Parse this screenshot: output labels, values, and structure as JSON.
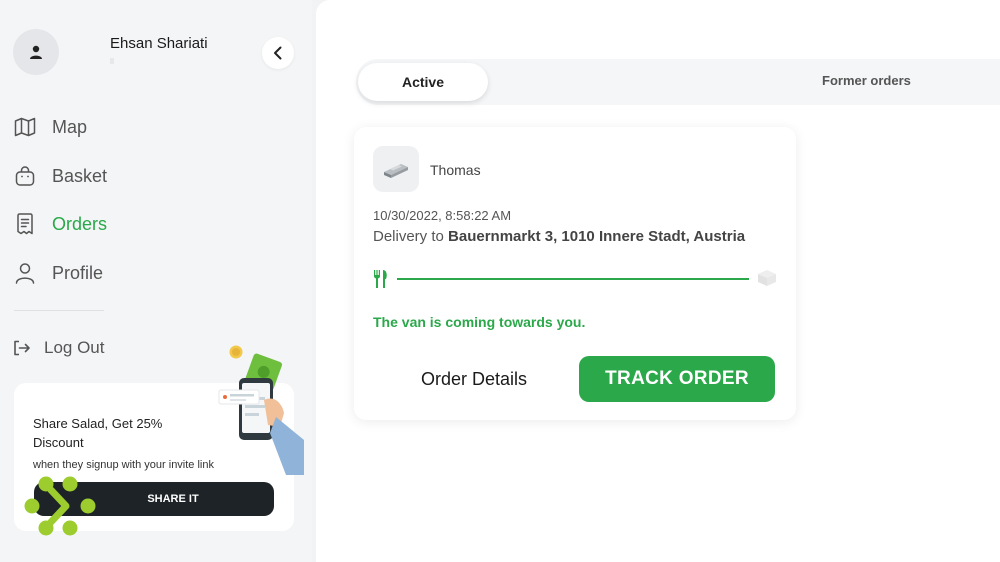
{
  "user": {
    "name": "Ehsan Shariati"
  },
  "nav": {
    "items": [
      {
        "label": "Map",
        "icon": "map-icon",
        "active": false
      },
      {
        "label": "Basket",
        "icon": "basket-icon",
        "active": false
      },
      {
        "label": "Orders",
        "icon": "receipt-icon",
        "active": true
      },
      {
        "label": "Profile",
        "icon": "user-icon",
        "active": false
      }
    ],
    "logout_label": "Log Out"
  },
  "promo": {
    "title": "Share Salad, Get 25% Discount",
    "subtitle": "when they signup with your invite link",
    "button_label": "SHARE IT"
  },
  "tabs": {
    "active_label": "Active",
    "former_label": "Former orders"
  },
  "order": {
    "restaurant_name": "Thomas",
    "datetime": "10/30/2022, 8:58:22 AM",
    "delivery_prefix": "Delivery to",
    "delivery_address": "Bauernmarkt 3, 1010 Innere Stadt, Austria",
    "progress": 1.0,
    "status_text": "The van is coming towards you.",
    "details_label": "Order Details",
    "track_label": "TRACK ORDER"
  },
  "colors": {
    "accent": "#2ba84a",
    "dark_button": "#1d2326",
    "logo_green": "#9ccc2e"
  }
}
